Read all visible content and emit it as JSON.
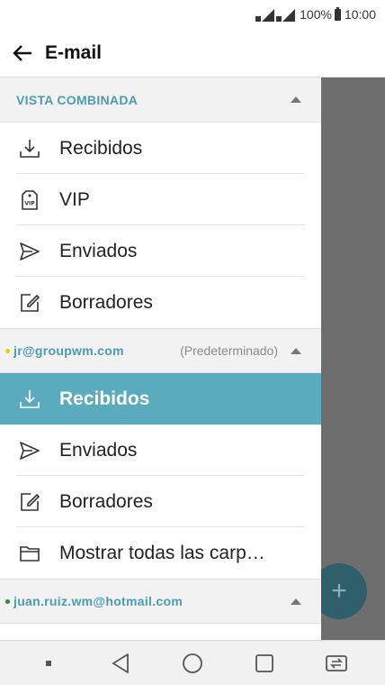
{
  "status": {
    "battery": "100%",
    "time": "10:00"
  },
  "app_bar": {
    "title": "E-mail"
  },
  "combined": {
    "header": "VISTA COMBINADA",
    "items": [
      {
        "label": "Recibidos",
        "icon": "inbox-download-icon"
      },
      {
        "label": "VIP",
        "icon": "vip-tag-icon"
      },
      {
        "label": "Enviados",
        "icon": "send-icon"
      },
      {
        "label": "Borradores",
        "icon": "draft-edit-icon"
      }
    ]
  },
  "account1": {
    "email": "jr@groupwm.com",
    "tag": "(Predeterminado)",
    "items": [
      {
        "label": "Recibidos",
        "icon": "inbox-download-icon"
      },
      {
        "label": "Enviados",
        "icon": "send-icon"
      },
      {
        "label": "Borradores",
        "icon": "draft-edit-icon"
      },
      {
        "label": "Mostrar todas las carp…",
        "icon": "folder-icon"
      }
    ]
  },
  "account2": {
    "email": "juan.ruiz.wm@hotmail.com"
  },
  "colors": {
    "accent": "#5aabbd",
    "header_text": "#4a9bb3",
    "fab": "#2e5f6a"
  }
}
